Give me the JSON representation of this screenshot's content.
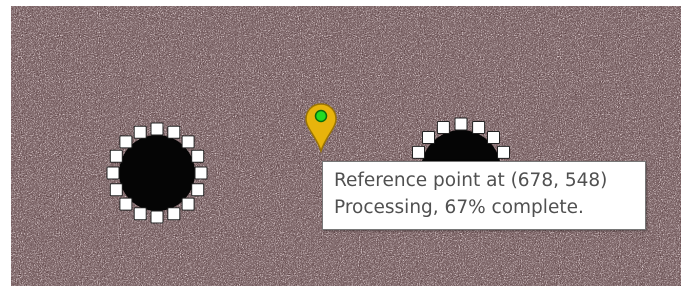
{
  "viewer": {
    "background_color": "#5e4446",
    "grain_light_color": "#b89c9e",
    "grain_dark_color": "#3a2628"
  },
  "selection": {
    "handle_fill": "#ffffff",
    "handle_stroke": "#222222",
    "blob_fill": "#050505"
  },
  "marker": {
    "icon": "map-pin-icon",
    "pin_color": "#e8b40c",
    "pin_outline": "#9a7406",
    "dot_color": "#22dd22"
  },
  "tooltip": {
    "line1": "Reference point at (678, 548)",
    "line2": "Processing, 67% complete."
  }
}
